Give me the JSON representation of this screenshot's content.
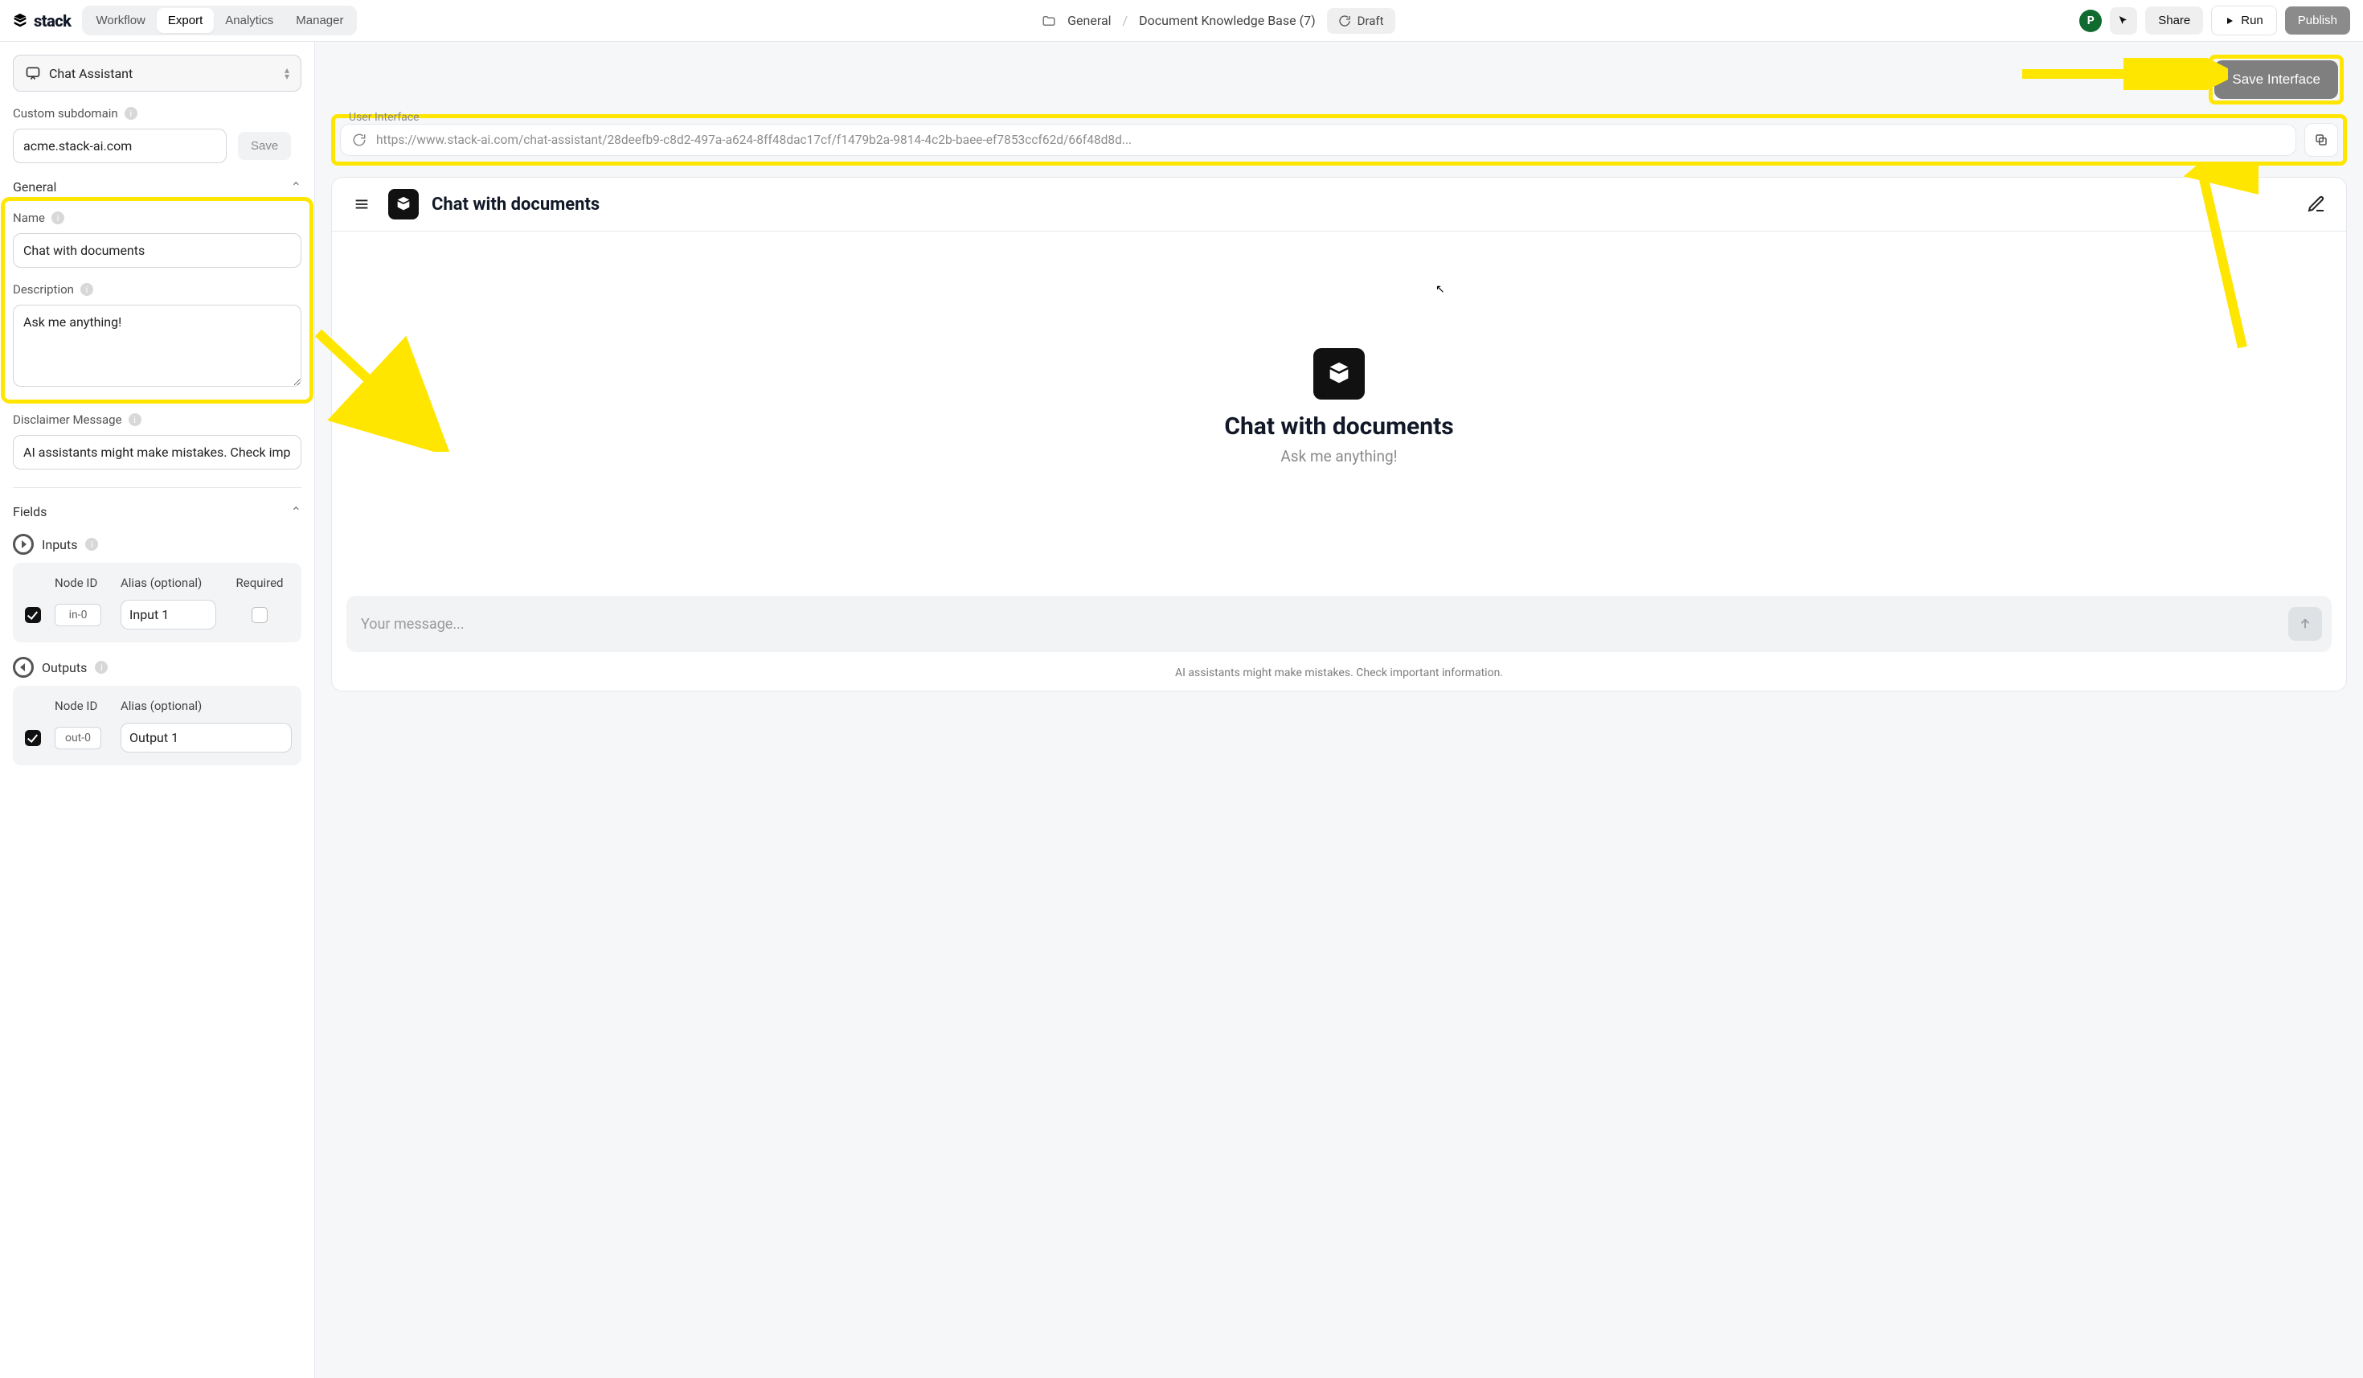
{
  "brand": "stack",
  "top_tabs": {
    "workflow": "Workflow",
    "export": "Export",
    "analytics": "Analytics",
    "manager": "Manager"
  },
  "breadcrumb": {
    "folder": "General",
    "page": "Document Knowledge Base (7)",
    "status": "Draft"
  },
  "top_right": {
    "avatar_initial": "P",
    "share": "Share",
    "run": "Run",
    "publish": "Publish"
  },
  "sidebar": {
    "panel_name": "Chat Assistant",
    "subdomain_label": "Custom subdomain",
    "subdomain_value": "acme.stack-ai.com",
    "save": "Save",
    "general_title": "General",
    "name_label": "Name",
    "name_value": "Chat with documents",
    "desc_label": "Description",
    "desc_value": "Ask me anything!",
    "disclaimer_label": "Disclaimer Message",
    "disclaimer_value": "AI assistants might make mistakes. Check important in",
    "fields_title": "Fields",
    "inputs_title": "Inputs",
    "outputs_title": "Outputs",
    "th_node": "Node ID",
    "th_alias": "Alias (optional)",
    "th_req": "Required",
    "in_id": "in-0",
    "in_alias": "Input 1",
    "out_id": "out-0",
    "out_alias": "Output 1"
  },
  "workspace": {
    "save_interface": "Save Interface",
    "ui_label": "User Interface",
    "url": "https://www.stack-ai.com/chat-assistant/28deefb9-c8d2-497a-a624-8ff48dac17cf/f1479b2a-9814-4c2b-baee-ef7853ccf62d/66f48d8d...",
    "preview_title": "Chat with documents",
    "preview_heading": "Chat with documents",
    "preview_sub": "Ask me anything!",
    "preview_placeholder": "Your message...",
    "preview_disclaimer": "AI assistants might make mistakes. Check important information."
  }
}
